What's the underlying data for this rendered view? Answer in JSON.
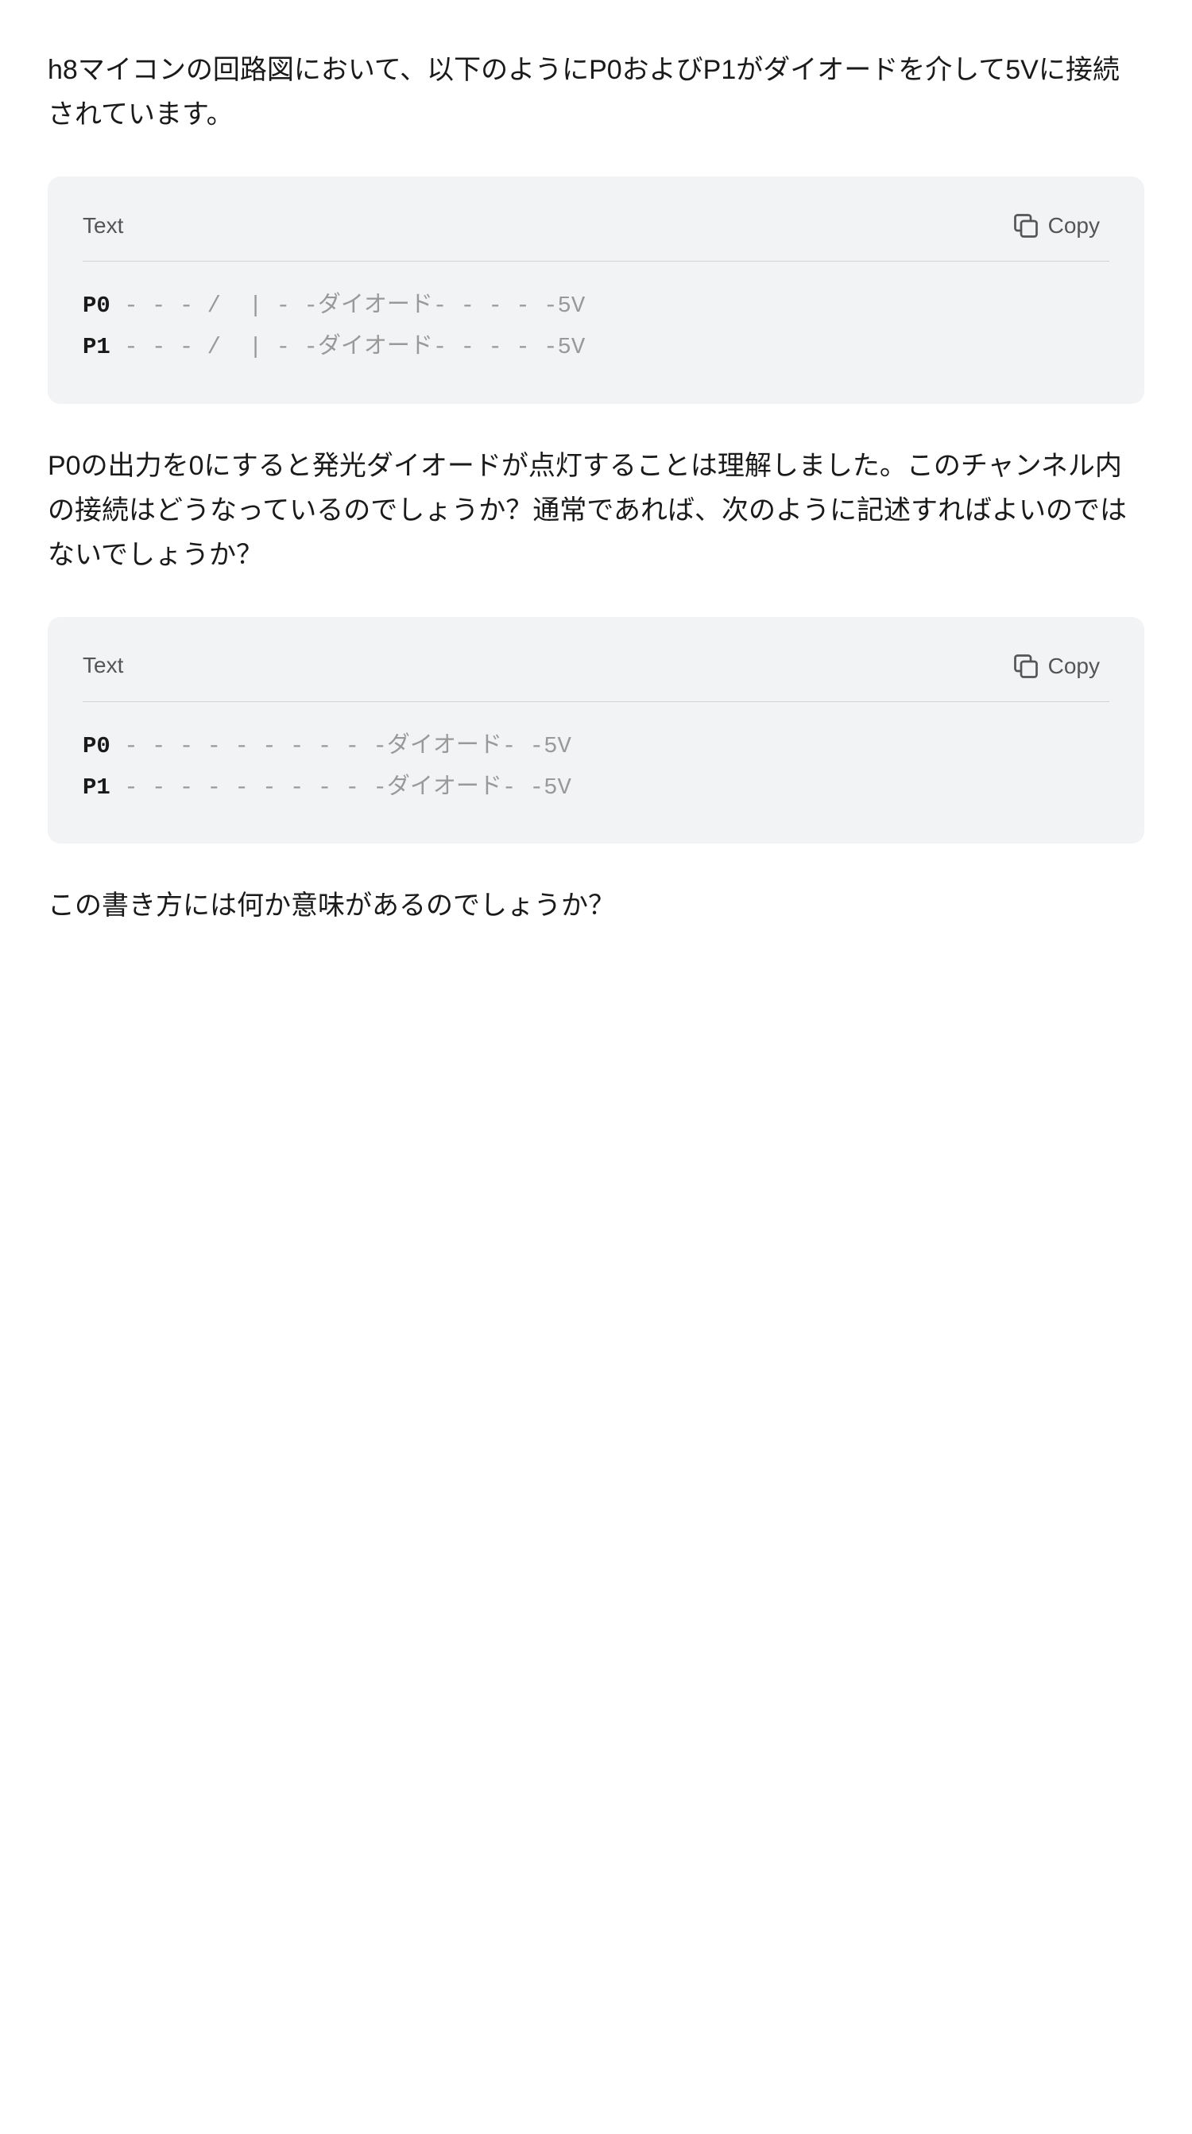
{
  "intro_text": "h8マイコンの回路図において、以下のようにP0およびP1がダイオードを介して5Vに接続されています。",
  "code_block_1": {
    "label": "Text",
    "copy_label": "Copy",
    "lines": [
      {
        "port": "P0",
        "content": " - - - /  | - -ダイオード- - - - -5V"
      },
      {
        "port": "P1",
        "content": " - - - /  | - -ダイオード- - - - -5V"
      }
    ]
  },
  "middle_text": "P0の出力を0にすると発光ダイオードが点灯することは理解しました。このチャンネル内の接続はどうなっているのでしょうか？通常であれば、次のように記述すればよいのではないでしょうか？",
  "code_block_2": {
    "label": "Text",
    "copy_label": "Copy",
    "lines": [
      {
        "port": "P0",
        "content": " - - - - - - - - - -ダイオード- -5V"
      },
      {
        "port": "P1",
        "content": " - - - - - - - - - -ダイオード- -5V"
      }
    ]
  },
  "bottom_text": "この書き方には何か意味があるのでしょうか？",
  "icons": {
    "copy": "⧉"
  }
}
